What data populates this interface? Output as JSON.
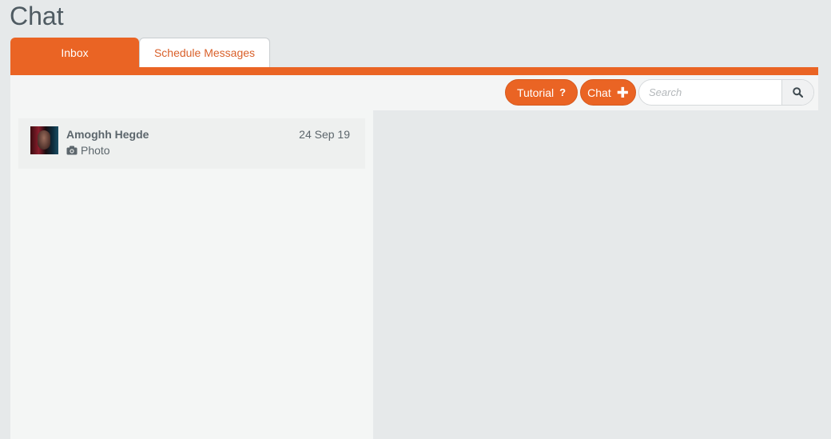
{
  "page": {
    "title": "Chat"
  },
  "tabs": [
    {
      "label": "Inbox",
      "active": true
    },
    {
      "label": "Schedule Messages",
      "active": false
    }
  ],
  "toolbar": {
    "tutorial_label": "Tutorial",
    "tutorial_icon": "question-icon",
    "chat_label": "Chat",
    "chat_icon": "plus-icon",
    "search_placeholder": "Search",
    "search_icon": "search-icon"
  },
  "conversations": [
    {
      "name": "Amoghh Hegde",
      "date": "24 Sep 19",
      "preview": "Photo",
      "preview_icon": "camera-icon"
    }
  ],
  "colors": {
    "accent": "#ea6424",
    "background": "#e6e9ea",
    "panel": "#f4f6f5",
    "text": "#5c666c"
  }
}
